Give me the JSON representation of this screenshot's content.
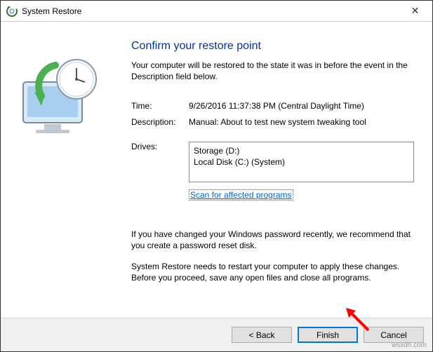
{
  "window": {
    "title": "System Restore"
  },
  "heading": "Confirm your restore point",
  "intro": "Your computer will be restored to the state it was in before the event in the Description field below.",
  "info": {
    "time_label": "Time:",
    "time_value": "9/26/2016 11:37:38 PM (Central Daylight Time)",
    "desc_label": "Description:",
    "desc_value": "Manual: About to test new system tweaking tool",
    "drives_label": "Drives:",
    "drives": [
      "Storage (D:)",
      "Local Disk (C:) (System)"
    ]
  },
  "scan_link": "Scan for affected programs",
  "note_password": "If you have changed your Windows password recently, we recommend that you create a password reset disk.",
  "note_restart": "System Restore needs to restart your computer to apply these changes. Before you proceed, save any open files and close all programs.",
  "buttons": {
    "back": "< Back",
    "finish": "Finish",
    "cancel": "Cancel"
  },
  "attribution": "wsxdn.com"
}
